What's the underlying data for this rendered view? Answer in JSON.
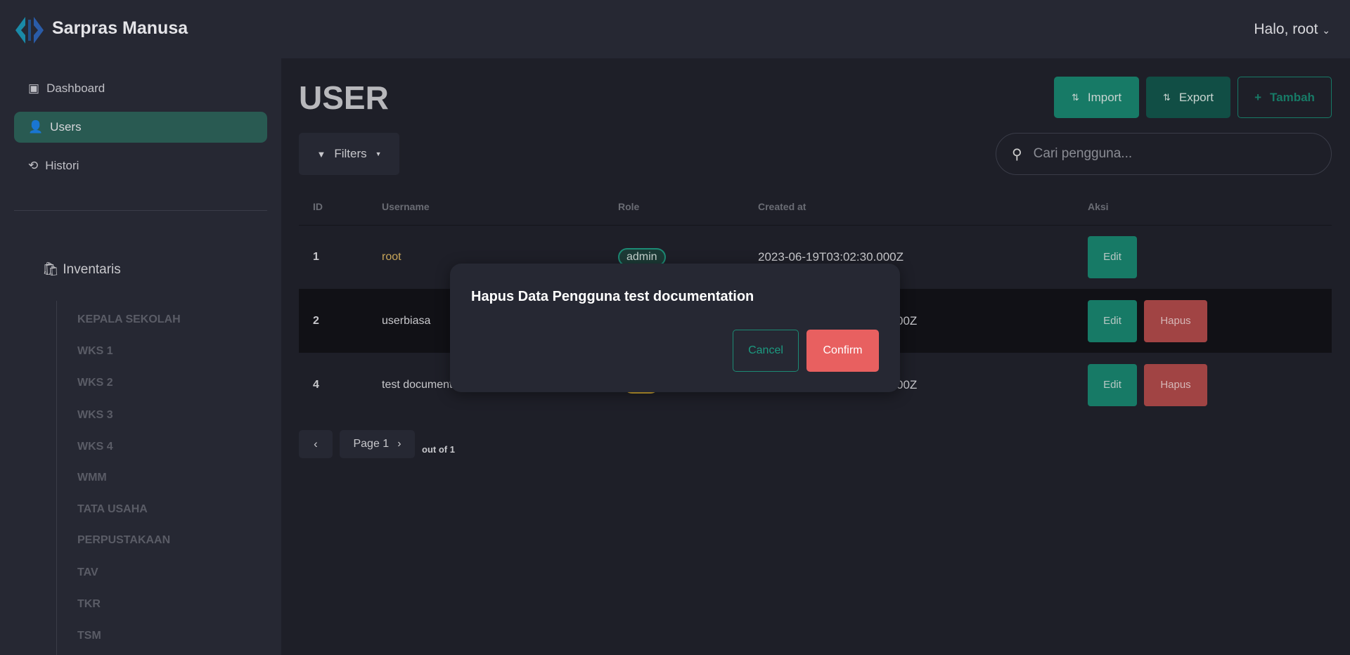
{
  "app": {
    "name": "Sarpras Manusa",
    "greeting": "Halo, root"
  },
  "sidebar": {
    "items": [
      {
        "label": "Dashboard",
        "icon": "dashboard-icon"
      },
      {
        "label": "Users",
        "icon": "user-check-icon",
        "active": true
      },
      {
        "label": "Histori",
        "icon": "history-icon"
      }
    ],
    "section": {
      "label": "Inventaris",
      "icon": "bag-icon"
    },
    "sub_items": [
      "KEPALA SEKOLAH",
      "WKS 1",
      "WKS 2",
      "WKS 3",
      "WKS 4",
      "WMM",
      "TATA USAHA",
      "PERPUSTAKAAN",
      "TAV",
      "TKR",
      "TSM"
    ]
  },
  "main": {
    "title": "USER",
    "import_label": "Import",
    "export_label": "Export",
    "add_label": "Tambah",
    "filters_label": "Filters",
    "search_placeholder": "Cari pengguna...",
    "columns": [
      "ID",
      "Username",
      "Role",
      "Created at",
      "Aksi"
    ],
    "rows": [
      {
        "id": "1",
        "username": "root",
        "role": "admin",
        "created": "2023-06-19T03:02:30.000Z",
        "edit": "Edit"
      },
      {
        "id": "2",
        "username": "userbiasa",
        "created": "00Z",
        "edit": "Edit",
        "delete": "Hapus"
      },
      {
        "id": "4",
        "username": "test documentation",
        "created": "00Z",
        "edit": "Edit",
        "delete": "Hapus"
      }
    ],
    "pagination": {
      "page": "Page 1",
      "out_of": "out of 1"
    }
  },
  "modal": {
    "title": "Hapus Data Pengguna test documentation",
    "cancel": "Cancel",
    "confirm": "Confirm"
  },
  "colors": {
    "accent": "#177a66",
    "danger": "#a14444",
    "confirm": "#e86060"
  }
}
